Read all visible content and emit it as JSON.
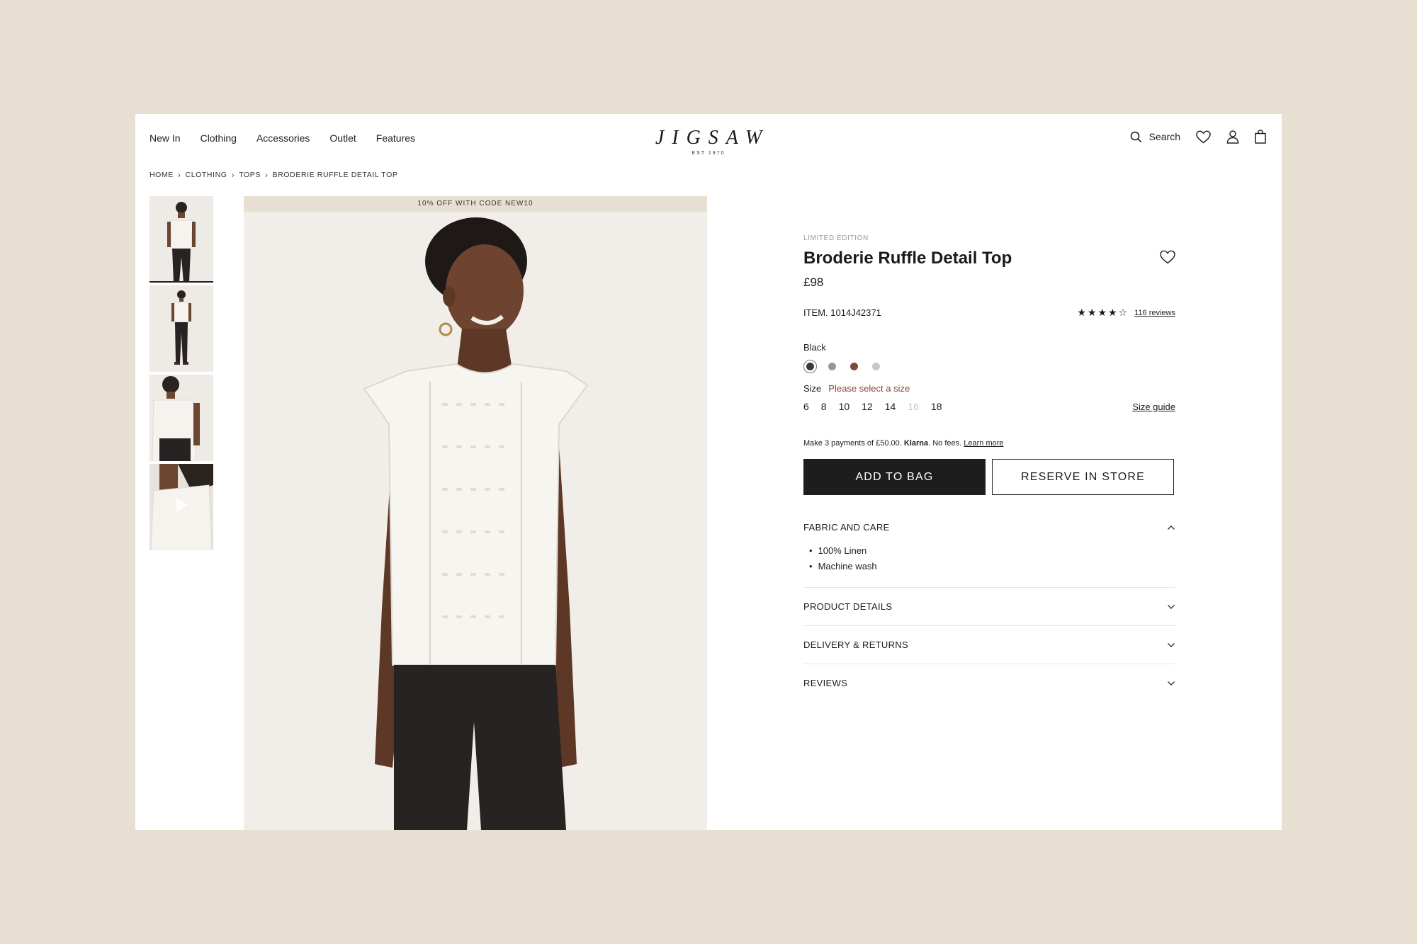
{
  "header": {
    "nav": [
      "New In",
      "Clothing",
      "Accessories",
      "Outlet",
      "Features"
    ],
    "brand": "JIGSAW",
    "brand_sub": "EST 1970",
    "search_label": "Search"
  },
  "breadcrumb": [
    "HOME",
    "CLOTHING",
    "TOPS",
    "BRODERIE RUFFLE DETAIL TOP"
  ],
  "gallery": {
    "promo": "10% OFF WITH CODE NEW10",
    "thumbnails": 4
  },
  "product": {
    "badge": "LIMITED EDITION",
    "title": "Broderie Ruffle Detail Top",
    "price": "£98",
    "item_code": "ITEM. 1014J42371",
    "rating": 4,
    "rating_stars": "★★★★☆",
    "reviews_label": "116 reviews",
    "colour_selected": "Black",
    "colours": [
      "#3b3b3b",
      "#9c978e",
      "#7e4a3a",
      "#c9c7c3"
    ],
    "size_label": "Size",
    "size_prompt": "Please select a size",
    "sizes": [
      "6",
      "8",
      "10",
      "12",
      "14",
      "16",
      "18"
    ],
    "unavailable_sizes": [
      "16"
    ],
    "size_guide": "Size guide",
    "klarna": {
      "prefix": "Make 3 payments of £50.00.",
      "brand": "Klarna",
      "suffix": ". No fees.",
      "link": "Learn more"
    },
    "add_to_bag": "ADD TO BAG",
    "reserve": "RESERVE IN STORE"
  },
  "accordion": [
    {
      "label": "FABRIC AND CARE",
      "open": true,
      "items": [
        "100% Linen",
        "Machine wash"
      ]
    },
    {
      "label": "PRODUCT DETAILS",
      "open": false
    },
    {
      "label": "DELIVERY & RETURNS",
      "open": false
    },
    {
      "label": "REVIEWS",
      "open": false
    }
  ]
}
